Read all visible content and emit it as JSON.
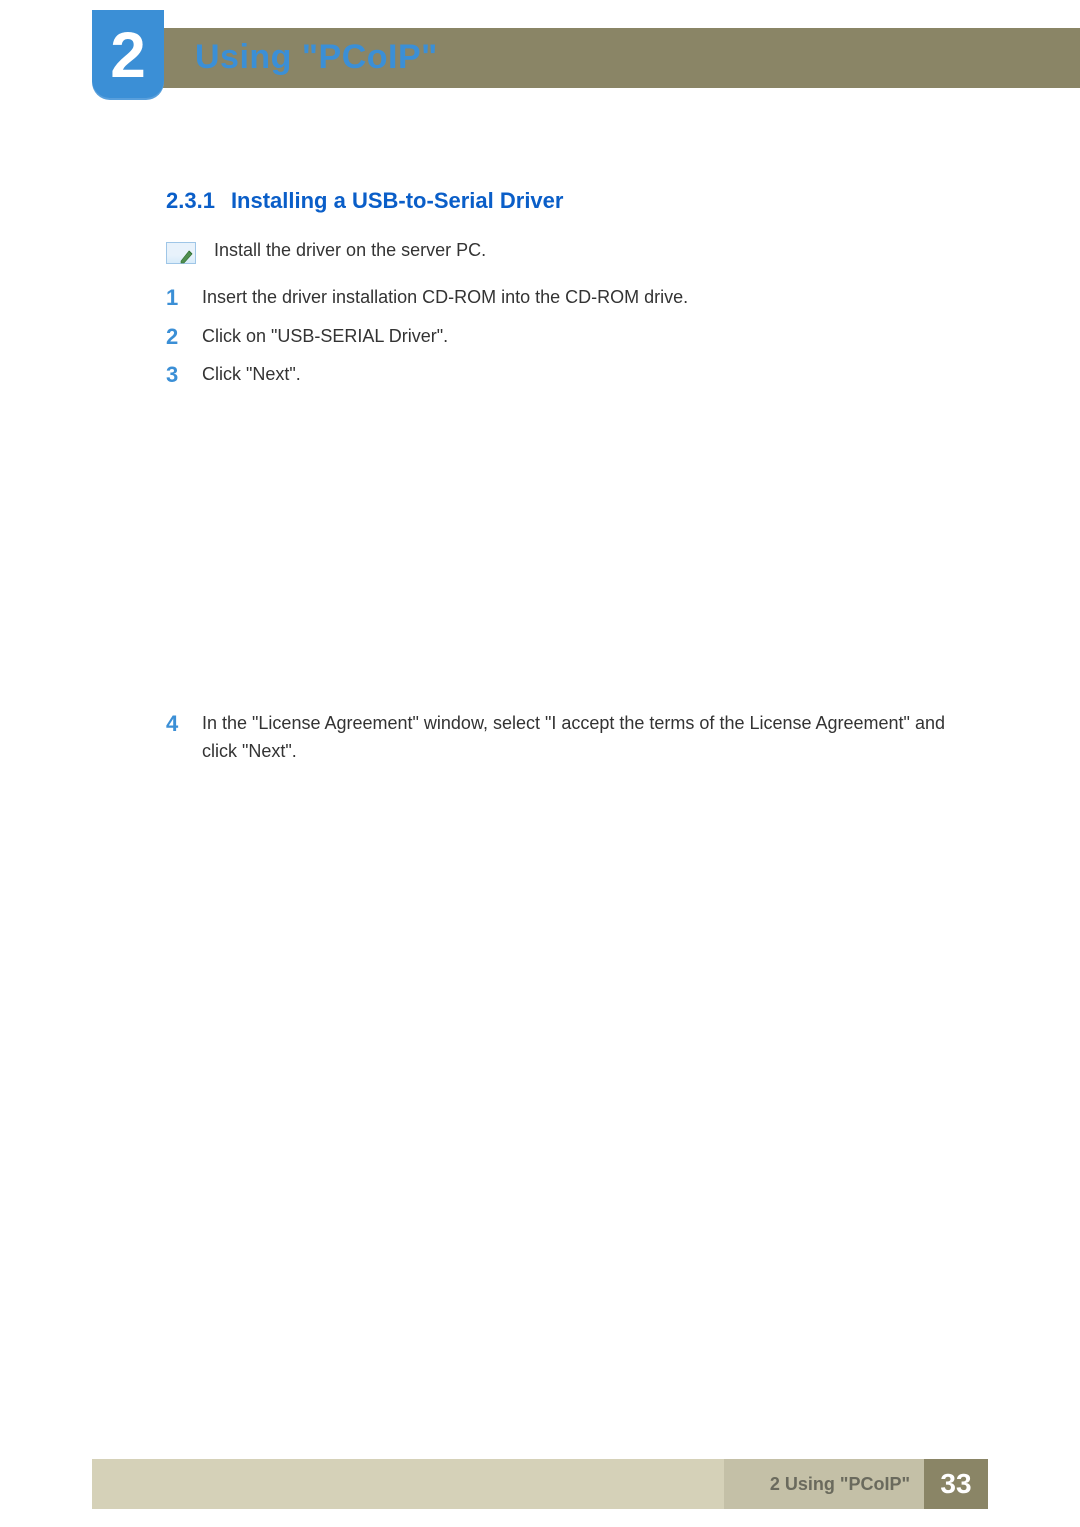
{
  "header": {
    "chapter_number": "2",
    "chapter_title": "Using \"PCoIP\""
  },
  "section": {
    "number": "2.3.1",
    "title": "Installing a USB-to-Serial Driver"
  },
  "note": {
    "text": "Install the driver on the server PC.",
    "icon_name": "note-icon"
  },
  "steps": [
    {
      "num": "1",
      "text": "Insert the driver installation CD-ROM into the CD-ROM drive."
    },
    {
      "num": "2",
      "text": "Click on \"USB-SERIAL Driver\"."
    },
    {
      "num": "3",
      "text": "Click \"Next\"."
    },
    {
      "num": "4",
      "text": "In the \"License Agreement\" window, select \"I accept the terms of the License Agreement\" and click \"Next\"."
    }
  ],
  "footer": {
    "label": "2 Using \"PCoIP\"",
    "page": "33"
  }
}
